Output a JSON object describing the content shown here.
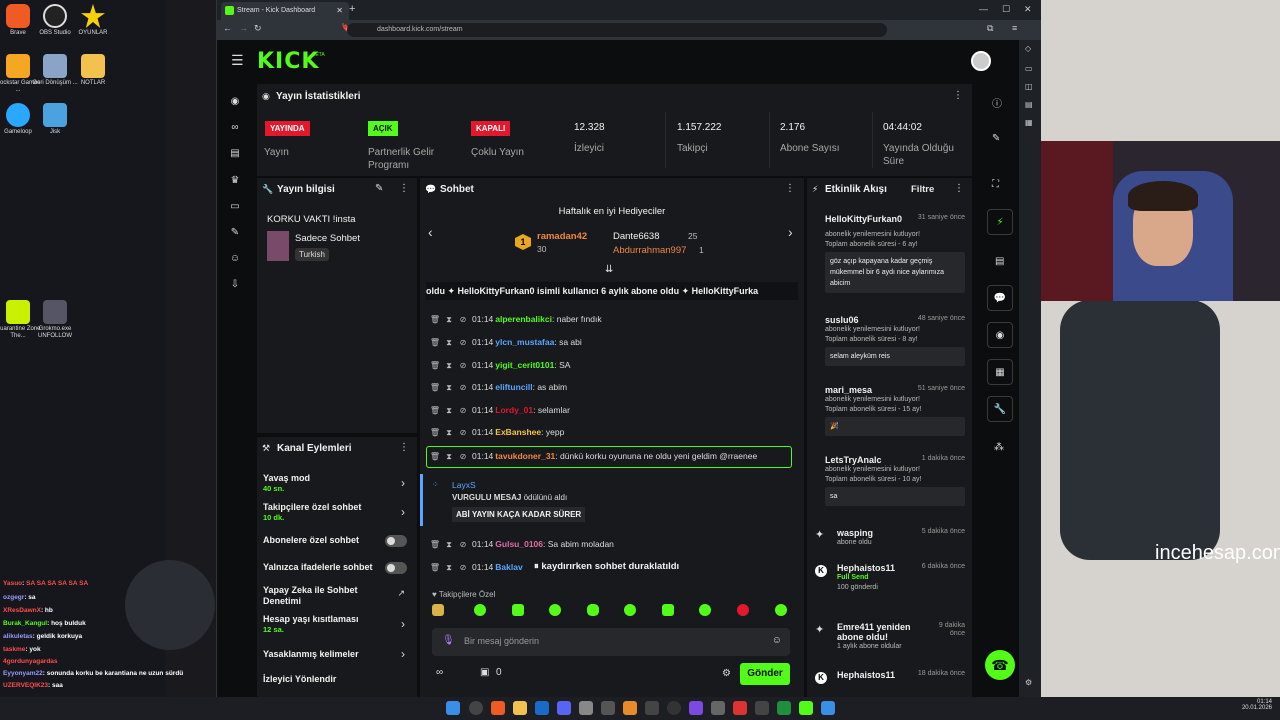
{
  "desktop": {
    "icons": [
      "Brave",
      "OBS Studio",
      "OYUNLAR",
      "Rockstar Games ...",
      "Geri Dönüşüm ...",
      "NOTLAR",
      "Gameloop",
      "Jisk",
      "Quarantine Zone The...",
      "Grokmo.exe UNFOLLOW"
    ],
    "watermark": "incehesap.com"
  },
  "browser": {
    "tab_title": "Stream - Kick Dashboard",
    "url": "dashboard.kick.com/stream",
    "new_tab": "+"
  },
  "kick": {
    "logo": "KICK",
    "beta": "BETA",
    "stats": {
      "title": "Yayın İstatistikleri",
      "items": [
        {
          "badge": "YAYINDA",
          "badge_color": "#e3182d",
          "label": "Yayın"
        },
        {
          "badge": "AÇIK",
          "badge_color": "#53fc18",
          "label": "Partnerlik Gelir Programı"
        },
        {
          "badge": "KAPALI",
          "badge_color": "#e3182d",
          "label": "Çoklu Yayın"
        },
        {
          "value": "12.328",
          "label": "İzleyici"
        },
        {
          "value": "1.157.222",
          "label": "Takipçi"
        },
        {
          "value": "2.176",
          "label": "Abone Sayısı"
        },
        {
          "value": "04:44:02",
          "label": "Yayında Olduğu Süre"
        }
      ]
    },
    "stream_info": {
      "title": "Yayın bilgisi",
      "stream_title": "KORKU VAKTI !insta",
      "category": "Sadece Sohbet",
      "language": "Turkish"
    },
    "channel_actions": {
      "title": "Kanal Eylemleri",
      "items": [
        {
          "label": "Yavaş mod",
          "sub": "40 sn.",
          "control": "chevron"
        },
        {
          "label": "Takipçilere özel sohbet",
          "sub": "10 dk.",
          "control": "chevron"
        },
        {
          "label": "Abonelere özel sohbet",
          "sub": "",
          "control": "toggle"
        },
        {
          "label": "Yalnızca ifadelerle sohbet",
          "sub": "",
          "control": "toggle"
        },
        {
          "label": "Yapay Zeka ile Sohbet Denetimi",
          "sub": "",
          "control": "external"
        },
        {
          "label": "Hesap yaşı kısıtlaması",
          "sub": "12 sa.",
          "control": "chevron"
        },
        {
          "label": "Yasaklanmış kelimeler",
          "sub": "",
          "control": "chevron"
        },
        {
          "label": "İzleyici Yönlendir",
          "sub": "",
          "control": "none"
        }
      ]
    },
    "chat": {
      "title": "Sohbet",
      "top_gifters_title": "Haftalık en iyi Hediyeciler",
      "gifters": [
        {
          "rank": "1",
          "name": "ramadan42",
          "count": "30"
        },
        {
          "name": "Dante6638",
          "count": "25"
        },
        {
          "name": "Abdurrahman997",
          "count": "1"
        }
      ],
      "banner": "oldu  ✦  HelloKittyFurkan0 isimli kullanıcı 6 aylık abone oldu  ✦  HelloKittyFurka",
      "banner_user": "HelloKittyFurkan0",
      "messages": [
        {
          "time": "01:14",
          "user": "alperenbalikci",
          "color": "#53fc18",
          "text": "naber fındık"
        },
        {
          "time": "01:14",
          "user": "ylcn_mustafaa",
          "color": "#58a6ff",
          "text": "sa abi"
        },
        {
          "time": "01:14",
          "user": "yigit_cerit0101",
          "color": "#53fc18",
          "text": "SA"
        },
        {
          "time": "01:14",
          "user": "eliftuncill",
          "color": "#58a6ff",
          "text": "as abim"
        },
        {
          "time": "01:14",
          "user": "Lordy_01",
          "color": "#e3182d",
          "text": "selamlar"
        },
        {
          "time": "01:14",
          "user": "ExBanshee",
          "color": "#f5c542",
          "text": "yepp"
        },
        {
          "time": "01:14",
          "user": "tavukdoner_31",
          "color": "#f0883e",
          "text": "dünkü korku oyununa ne oldu yeni geldim @rraenee"
        }
      ],
      "highlight": {
        "user": "LayxS",
        "label": "VURGULU MESAJ",
        "rest": "ödülünü aldı",
        "text": "ABİ YAYIN KAÇA KADAR SÜRER"
      },
      "after": [
        {
          "time": "01:14",
          "user": "Gulsu_0106",
          "color": "#e36ba7",
          "text": "Sa abim moladan"
        },
        {
          "time": "01:14",
          "user": "Baklav",
          "color": "#58a6ff",
          "text": ""
        }
      ],
      "paused": "kaydırırken sohbet duraklatıldı",
      "followers_only": "Takipçilere Özel",
      "input_placeholder": "Bir mesaj gönderin",
      "infinity": "∞",
      "points": "0",
      "send": "Gönder"
    },
    "activity": {
      "title": "Etkinlik Akışı",
      "filter": "Filtre",
      "events": [
        {
          "name": "HelloKittyFurkan0",
          "time": "31 saniye önce",
          "line1": "abonelik yenilemesini kutluyor!",
          "line2": "Toplam abonelik süresi - 6 ay!",
          "message": "göz açıp kapayana kadar geçmiş mükemmel bir 6 aydı nice aylarımıza abicim"
        },
        {
          "name": "suslu06",
          "time": "48 saniye önce",
          "line1": "abonelik yenilemesini kutluyor!",
          "line2": "Toplam abonelik süresi - 8 ay!",
          "message": "selam aleyküm reis"
        },
        {
          "name": "mari_mesa",
          "time": "51 saniye önce",
          "line1": "abonelik yenilemesini kutluyor!",
          "line2": "Toplam abonelik süresi - 15 ay!",
          "message": "🎉"
        },
        {
          "name": "LetsTryAnalc",
          "time": "1 dakika önce",
          "line1": "abonelik yenilemesini kutluyor!",
          "line2": "Toplam abonelik süresi - 10 ay!",
          "message": "sa"
        },
        {
          "name": "wasping",
          "time": "5 dakika önce",
          "line1": "abone oldu",
          "line2": "",
          "message": ""
        },
        {
          "name": "Hephaistos11",
          "time": "6 dakika önce",
          "line1": "Full Send",
          "line2": "100 gönderdi",
          "message": ""
        },
        {
          "name": "Emre411 yeniden abone oldu!",
          "time": "9 dakika önce",
          "line1": "1 aylık abone oldular",
          "line2": "",
          "message": ""
        },
        {
          "name": "Hephaistos11",
          "time": "18 dakika önce",
          "line1": "",
          "line2": "",
          "message": ""
        }
      ]
    }
  },
  "overlay_chat": [
    {
      "user": "Yasuo",
      "color": "#ff4d4d",
      "text": "SA SA SA SA SA SA"
    },
    {
      "user": "ozgegr",
      "color": "#9b9bff",
      "text": "sa"
    },
    {
      "user": "XResDawnX",
      "color": "#ff4d4d",
      "text": "hb"
    },
    {
      "user": "Burak_Kangul",
      "color": "#53fc18",
      "text": "hoş bulduk"
    },
    {
      "user": "alikuletas",
      "color": "#9b9bff",
      "text": "geldik korkuya"
    },
    {
      "user": "taskme",
      "color": "#ff4d4d",
      "text": "yok"
    },
    {
      "user": "4gordunyagardas",
      "color": "#ff4d4d",
      "text": ""
    },
    {
      "user": "Eyyonyam22",
      "color": "#9b9bff",
      "text": "sonunda korku be karantiana ne uzun sürdü"
    },
    {
      "user": "UZERVEQIK23",
      "color": "#ff4d4d",
      "text": "saa"
    }
  ],
  "taskbar": {
    "time": "01:14",
    "date": "20.01.2026"
  }
}
